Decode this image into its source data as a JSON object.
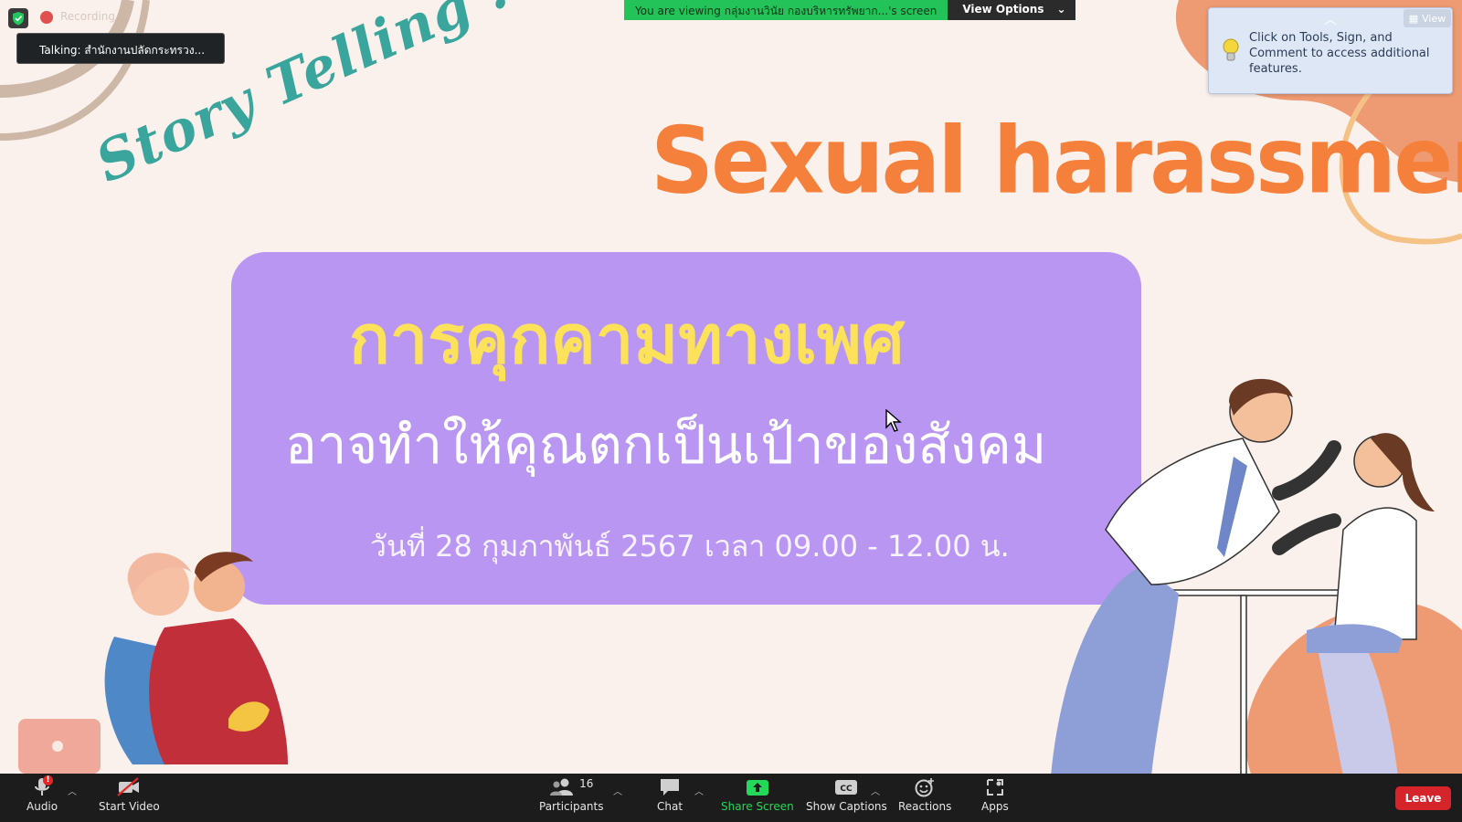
{
  "top_bar": {
    "recording_label": "Recording",
    "talking": "Talking: สำนักงานปลัดกระทรวง...",
    "viewing_banner": "You are viewing กลุ่มงานวินัย กองบริหารทรัพยาก...'s screen",
    "view_options": "View Options"
  },
  "pdf_tip": {
    "message": "Click on Tools, Sign, and Comment to access additional features.",
    "view_label": "View"
  },
  "slide": {
    "story_telling": "Story Telling !!!",
    "title_en": "Sexual harassment",
    "title_th": "การคุกคามทางเพศ",
    "subtitle_th": "อาจทำให้คุณตกเป็นเป้าของสังคม",
    "date_th": "วันที่ 28 กุมภาพันธ์ 2567 เวลา 09.00 - 12.00 น."
  },
  "toolbar": {
    "audio": "Audio",
    "start_video": "Start Video",
    "participants": "Participants",
    "participants_count": "16",
    "chat": "Chat",
    "share_screen": "Share Screen",
    "show_captions": "Show Captions",
    "reactions": "Reactions",
    "apps": "Apps",
    "leave": "Leave",
    "audio_badge": "!"
  },
  "colors": {
    "slide_bg": "#fbf1ec",
    "purple_box": "#b896f2",
    "title_orange": "#f5803b",
    "title_yellow": "#fce15b",
    "teal": "#3aa59c",
    "toolbar_bg": "#1c1c1c",
    "share_green": "#23d959",
    "leave_red": "#d6252a"
  }
}
